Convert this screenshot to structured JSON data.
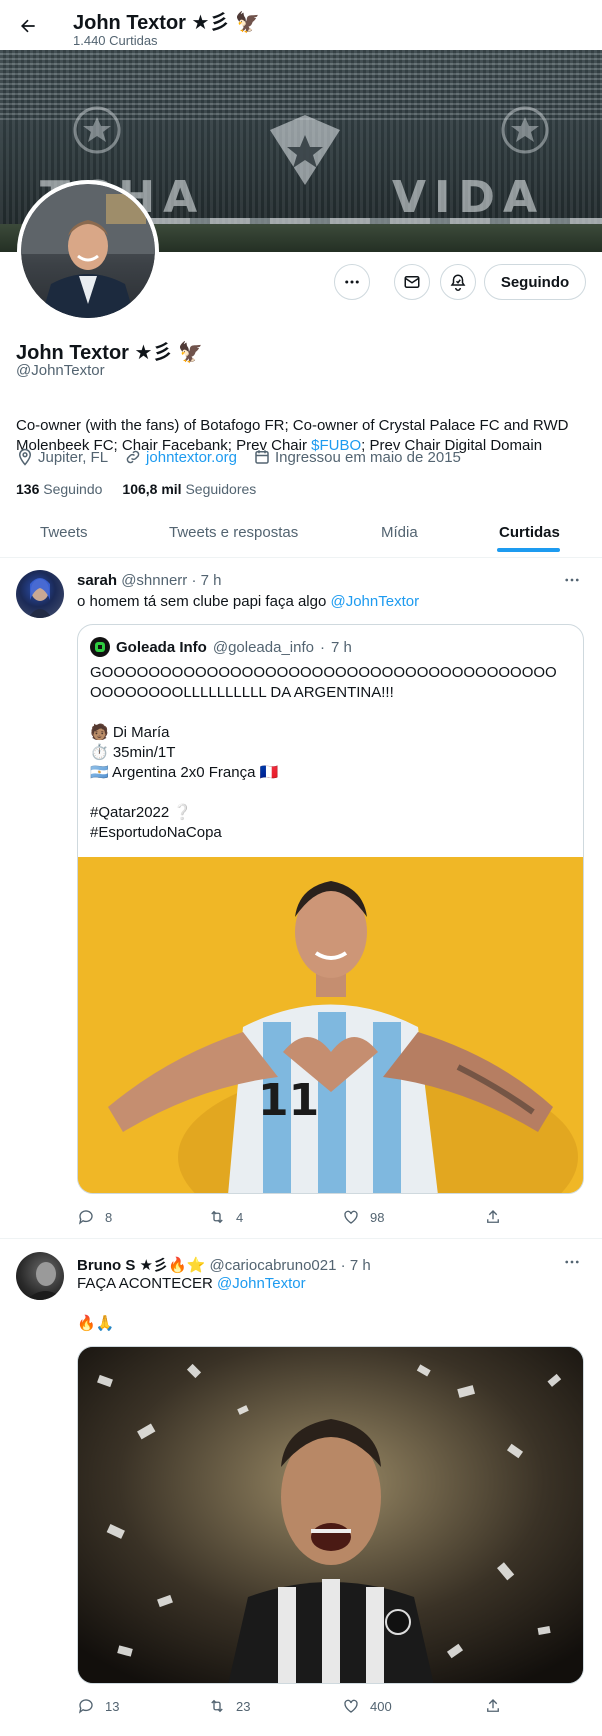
{
  "header": {
    "title": "John Textor ★彡 🦅",
    "subtitle": "1.440 Curtidas"
  },
  "banner": {
    "left_text": "TCHA",
    "right_text": "VIDA"
  },
  "profile": {
    "name": "John Textor ★彡 🦅",
    "handle": "@JohnTextor",
    "bio_part1": "Co-owner (with the fans) of Botafogo FR; Co-owner of Crystal Palace FC and RWD Molenbeek FC; Chair Facebank; Prev Chair ",
    "bio_link": "$FUBO",
    "bio_part2": "; Prev Chair Digital Domain",
    "location": "Jupiter, FL",
    "website": "johntextor.org",
    "joined": "Ingressou em maio de 2015",
    "following_count": "136",
    "following_label": "Seguindo",
    "followers_count": "106,8 mil",
    "followers_label": "Seguidores",
    "follow_button": "Seguindo"
  },
  "tabs": [
    {
      "label": "Tweets"
    },
    {
      "label": "Tweets e respostas"
    },
    {
      "label": "Mídia"
    },
    {
      "label": "Curtidas"
    }
  ],
  "tweets": [
    {
      "name": "sarah",
      "handle": "@shnnerr",
      "time": "7 h",
      "text_before": "o homem tá sem clube papi faça algo ",
      "mention": "@JohnTextor",
      "quote": {
        "name": "Goleada Info",
        "handle": "@goleada_info",
        "time": "7 h",
        "lines": [
          "GOOOOOOOOOOOOOOOOOOOOOOOOOOOOOOOOOOOOOOO",
          "OOOOOOOOLLLLLLLLLL DA ARGENTINA!!!",
          "",
          "🧑🏽 Di María",
          "⏱️ 35min/1T",
          "🇦🇷 Argentina 2x0 França 🇫🇷",
          "",
          "#Qatar2022 ❔",
          "#EsportudoNaCopa"
        ],
        "jersey_number": "11"
      },
      "replies": "8",
      "retweets": "4",
      "likes": "98"
    },
    {
      "name": "Bruno S ★彡🔥⭐",
      "handle": "@cariocabruno021",
      "time": "7 h",
      "text_before": "FAÇA ACONTECER ",
      "mention": "@JohnTextor",
      "text_line2": "🔥🙏",
      "replies": "13",
      "retweets": "23",
      "likes": "400"
    }
  ],
  "colors": {
    "accent": "#1d9bf0",
    "muted": "#536471",
    "border": "#cfd9de",
    "quote_image_bg": "#f0b726"
  },
  "icons": [
    "back-arrow-icon",
    "more-icon",
    "mail-icon",
    "notify-icon",
    "location-icon",
    "link-icon",
    "calendar-icon",
    "reply-icon",
    "retweet-icon",
    "like-icon",
    "share-icon"
  ]
}
